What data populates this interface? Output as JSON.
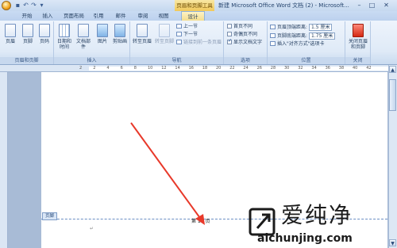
{
  "title_bar": {
    "context_tab_title": "页眉和页脚工具",
    "window_title": "新建 Microsoft Office Word 文档 (2) - Microsoft..."
  },
  "tabs": [
    "开始",
    "插入",
    "页面布局",
    "引用",
    "邮件",
    "审阅",
    "视图",
    "设计"
  ],
  "active_tab": "设计",
  "groups": {
    "header_footer": {
      "label": "页眉和页脚",
      "buttons": [
        "页眉",
        "页脚",
        "页码"
      ]
    },
    "insert": {
      "label": "插入",
      "buttons": [
        "日期和时间",
        "文档部件",
        "图片",
        "剪贴画"
      ]
    },
    "navigation": {
      "label": "导航",
      "buttons": [
        "转至页眉",
        "转至页脚"
      ],
      "small": [
        "上一节",
        "下一节",
        "链接到前一条页眉"
      ]
    },
    "options": {
      "label": "选项",
      "checks": [
        {
          "label": "首页不同",
          "checked": false
        },
        {
          "label": "奇偶页不同",
          "checked": false
        },
        {
          "label": "显示文档文字",
          "checked": true
        }
      ]
    },
    "position": {
      "label": "位置",
      "header_distance_label": "页眉顶端距离:",
      "header_distance_value": "1.5 厘米",
      "footer_distance_label": "页脚底端距离:",
      "footer_distance_value": "1.75 厘米",
      "insert_tab_label": "插入\"对齐方式\"选项卡"
    },
    "close": {
      "label": "关闭",
      "button": "关闭页眉和页脚"
    }
  },
  "ruler": {
    "numbers": [
      "2",
      "2",
      "4",
      "6",
      "8",
      "10",
      "12",
      "14",
      "16",
      "18",
      "20",
      "22",
      "24",
      "26",
      "28",
      "30",
      "32",
      "34",
      "36",
      "38",
      "40",
      "42"
    ]
  },
  "document": {
    "footer_tag": "页脚",
    "footer_text": "第 10 页"
  },
  "watermark": {
    "cn": "爱纯净",
    "en": "aichunjing.com"
  },
  "colors": {
    "accent": "#f1c95a",
    "arrow": "#e8392a"
  }
}
